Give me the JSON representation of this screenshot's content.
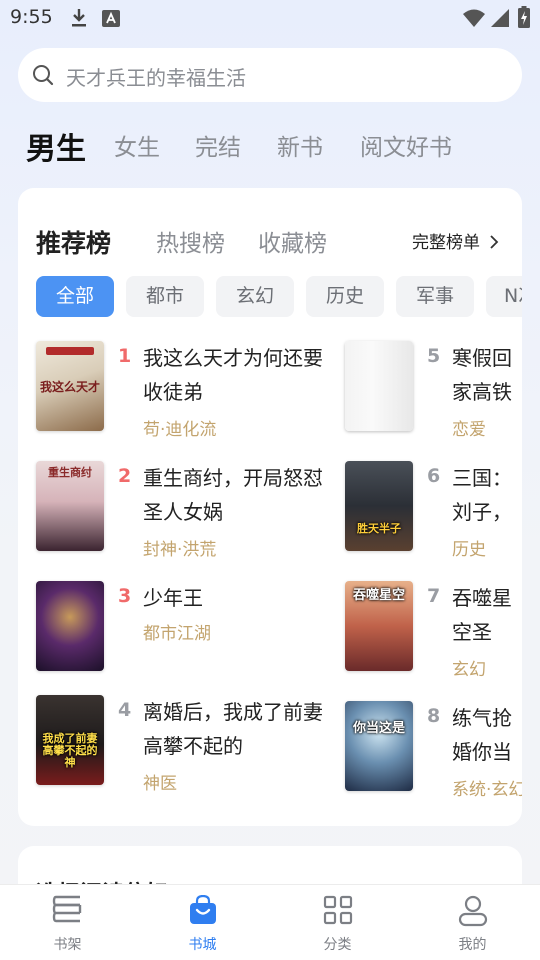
{
  "status_bar": {
    "time": "9:55"
  },
  "search": {
    "placeholder": "天才兵王的幸福生活"
  },
  "gender_tabs": [
    {
      "label": "男生",
      "active": true
    },
    {
      "label": "女生",
      "active": false
    },
    {
      "label": "完结",
      "active": false
    },
    {
      "label": "新书",
      "active": false
    },
    {
      "label": "阅文好书",
      "active": false
    }
  ],
  "ranking": {
    "tabs": [
      {
        "label": "推荐榜",
        "active": true
      },
      {
        "label": "热搜榜",
        "active": false
      },
      {
        "label": "收藏榜",
        "active": false
      }
    ],
    "full_list_label": "完整榜单",
    "chips": [
      {
        "label": "全部",
        "active": true
      },
      {
        "label": "都市",
        "active": false
      },
      {
        "label": "玄幻",
        "active": false
      },
      {
        "label": "历史",
        "active": false
      },
      {
        "label": "军事",
        "active": false
      },
      {
        "label": "N次",
        "active": false
      }
    ],
    "books": [
      {
        "rank": "1",
        "title": "我这么天才为何还要收徒弟",
        "category": "苟·迪化流",
        "cover_text": "我这么天才",
        "rank_color": "#f06a6a"
      },
      {
        "rank": "2",
        "title": "重生商纣，开局怒怼圣人女娲",
        "category": "封神·洪荒",
        "cover_text": "重生商纣",
        "rank_color": "#f06a6a"
      },
      {
        "rank": "3",
        "title": "少年王",
        "category": "都市江湖",
        "cover_text": "",
        "rank_color": "#f06a6a"
      },
      {
        "rank": "4",
        "title": "离婚后，我成了前妻高攀不起的",
        "category": "神医",
        "cover_text": "我成了前妻高攀不起的神",
        "rank_color": "#9a9da3"
      },
      {
        "rank": "5",
        "title": "寒假回家高铁偶遇",
        "category": "恋爱",
        "cover_text": "",
        "rank_color": "#9a9da3"
      },
      {
        "rank": "6",
        "title": "三国：刘子，你管",
        "category": "历史",
        "cover_text": "胜天半子",
        "rank_color": "#9a9da3"
      },
      {
        "rank": "7",
        "title": "吞噬星空圣",
        "category": "玄幻",
        "cover_text": "吞噬星空",
        "rank_color": "#9a9da3"
      },
      {
        "rank": "8",
        "title": "练气抢婚你当这是",
        "category": "系统·玄幻",
        "cover_text": "你当这是",
        "rank_color": "#9a9da3"
      }
    ]
  },
  "second_card": {
    "title": "选择阅读偏好"
  },
  "bottom_nav": [
    {
      "label": "书架",
      "icon": "bookshelf-icon",
      "active": false
    },
    {
      "label": "书城",
      "icon": "store-bag-icon",
      "active": true
    },
    {
      "label": "分类",
      "icon": "grid-icon",
      "active": false
    },
    {
      "label": "我的",
      "icon": "profile-icon",
      "active": false
    }
  ],
  "colors": {
    "accent": "#4c93f3",
    "nav_active": "#2f7ef0",
    "category": "#c3a46e",
    "rank_top": "#f06a6a"
  }
}
